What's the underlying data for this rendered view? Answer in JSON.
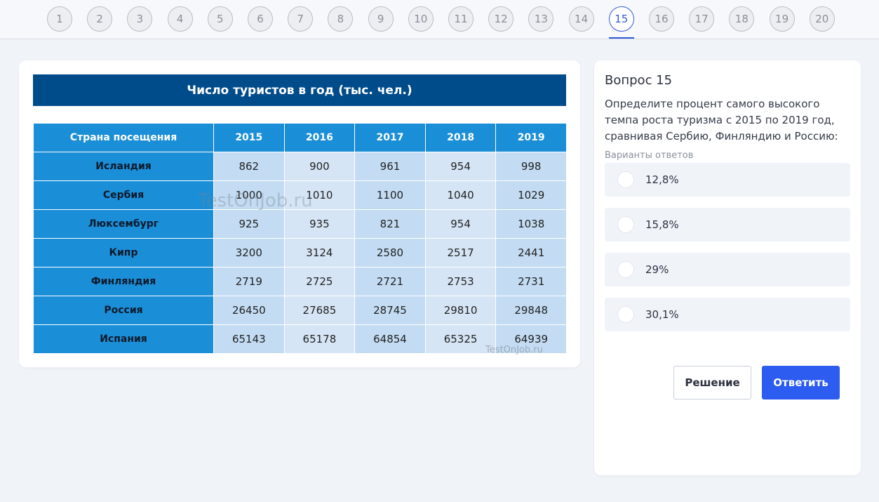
{
  "nav": {
    "questions": [
      "1",
      "2",
      "3",
      "4",
      "5",
      "6",
      "7",
      "8",
      "9",
      "10",
      "11",
      "12",
      "13",
      "14",
      "15",
      "16",
      "17",
      "18",
      "19",
      "20"
    ],
    "active_index": 14
  },
  "table": {
    "title": "Число туристов в год (тыс. чел.)",
    "header": [
      "Страна посещения",
      "2015",
      "2016",
      "2017",
      "2018",
      "2019"
    ],
    "rows": [
      {
        "country": "Исландия",
        "values": [
          "862",
          "900",
          "961",
          "954",
          "998"
        ]
      },
      {
        "country": "Сербия",
        "values": [
          "1000",
          "1010",
          "1100",
          "1040",
          "1029"
        ]
      },
      {
        "country": "Люксембург",
        "values": [
          "925",
          "935",
          "821",
          "954",
          "1038"
        ]
      },
      {
        "country": "Кипр",
        "values": [
          "3200",
          "3124",
          "2580",
          "2517",
          "2441"
        ]
      },
      {
        "country": "Финляндия",
        "values": [
          "2719",
          "2725",
          "2721",
          "2753",
          "2731"
        ]
      },
      {
        "country": "Россия",
        "values": [
          "26450",
          "27685",
          "28745",
          "29810",
          "29848"
        ]
      },
      {
        "country": "Испания",
        "values": [
          "65143",
          "65178",
          "64854",
          "65325",
          "64939"
        ]
      }
    ],
    "watermark": "TestOnJob.ru",
    "watermark_small": "TestOnJob.ru"
  },
  "question": {
    "title": "Вопрос 15",
    "text": "Определите процент самого высокого темпа роста туризма с 2015 по 2019 год, сравнивая Сербию, Финляндию и Россию:",
    "answers_label": "Варианты ответов",
    "options": [
      "12,8%",
      "15,8%",
      "29%",
      "30,1%"
    ],
    "solution_button": "Решение",
    "answer_button": "Ответить"
  },
  "colors": {
    "accent": "#2c5cf0",
    "table_title_bg": "#004c8b",
    "table_header_bg": "#1b8ed8"
  }
}
